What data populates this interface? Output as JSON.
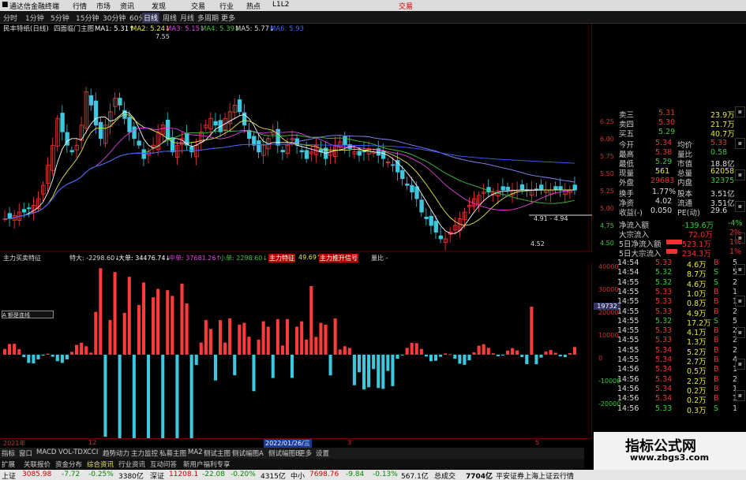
{
  "title_bar": {
    "app_title": "通达信金融终端",
    "menus": [
      "行情",
      "市场",
      "资讯",
      "发现",
      "交易",
      "行业",
      "热点",
      "L1L2"
    ],
    "trade_label": "交易"
  },
  "toolbar": {
    "periods": [
      "分时",
      "1分钟",
      "5分钟",
      "15分钟",
      "30分钟",
      "60分钟",
      "日线",
      "周线",
      "月线",
      "多周期",
      "更多"
    ]
  },
  "main_legend": {
    "chart_name": "民丰特纸(日线)",
    "indicator_name": "四面临门主图",
    "ma1": "MA1: 5.31↑",
    "ma2": "MA2: 5.24↓",
    "ma3": "MA3: 5.15↓",
    "ma4": "MA4: 5.39↓",
    "ma5": "MA5: 5.77↓",
    "ma6": "MA6: 5.93"
  },
  "main_labels": {
    "high": "7.55",
    "low": "4.52",
    "range": "4.91 - 4.94"
  },
  "price_axis": [
    "6.25",
    "6.00",
    "5.75",
    "5.50",
    "5.25",
    "5.00",
    "4.75",
    "4.50"
  ],
  "indicator_header": {
    "name": "主力买卖特征",
    "item1": "特大: -2298.60↓",
    "item2": "大单: 34476.74↓",
    "item3": "中单: 37681.26↑",
    "item4": "小单: 2298.60↓",
    "item5": "主力特征",
    "item6": "49.69↑",
    "item7": "主力推升信号",
    "item8": "量比 -"
  },
  "indicator_axis": [
    "40000",
    "30000",
    "20000",
    "10000",
    "0",
    "-10000",
    "-20000"
  ],
  "indicator_value_box": "19732",
  "side_label": "A 额是连线",
  "date_bar": {
    "left_year": "2021年",
    "month_12": "12",
    "date_box": "2022/01/26/三",
    "month_3": "3",
    "month_5": "5"
  },
  "bottom_tabs": [
    "指标",
    "窗口",
    "MACD",
    "VOL-TDX",
    "CCI",
    "趋势动力",
    "主力监控",
    "私募主图",
    "MA2",
    "侧试主图",
    "侧试幅图A",
    "侧试幅图B",
    "更多",
    "设置"
  ],
  "bottom_tabs2": [
    "扩展",
    "关联报价",
    "资金分布",
    "综合资讯",
    "行业资讯",
    "互动问答",
    "新用户福利专享"
  ],
  "order_book_top": [
    {
      "label": "卖三",
      "price": "5.31",
      "vol": "23.9万"
    },
    {
      "label": "卖四",
      "price": "5.30",
      "vol": "21.7万"
    },
    {
      "label": "买五",
      "price": "5.29",
      "vol": "40.7万"
    }
  ],
  "stats": [
    {
      "l1": "今开",
      "v1": "5.34",
      "l2": "均价",
      "v2": "5.33"
    },
    {
      "l1": "最高",
      "v1": "5.38",
      "l2": "量比",
      "v2": "0.58"
    },
    {
      "l1": "最低",
      "v1": "5.29",
      "l2": "市值",
      "v2": "18.8亿"
    },
    {
      "l1": "现量",
      "v1": "561",
      "l2": "总量",
      "v2": "62058"
    },
    {
      "l1": "外盘",
      "v1": "29683",
      "l2": "内盘",
      "v2": "32375"
    }
  ],
  "stats2": [
    {
      "l1": "换手",
      "v1": "1.77%",
      "l2": "股本",
      "v2": "3.51亿"
    },
    {
      "l1": "净资",
      "v1": "4.02",
      "l2": "流通",
      "v2": "3.51亿"
    },
    {
      "l1": "收益(-)",
      "v1": "0.050",
      "l2": "PE(动)",
      "v2": "29.6"
    }
  ],
  "flows": [
    {
      "label": "净流入额",
      "value": "-139.6万",
      "pct": "-4%"
    },
    {
      "label": "大宗流入",
      "value": "72.0万",
      "pct": "2%"
    },
    {
      "label": "5日净流入额",
      "value": "523.1万",
      "pct": "1%"
    },
    {
      "label": "5日大宗流入",
      "value": "234.3万",
      "pct": "1%"
    }
  ],
  "ticks": [
    {
      "time": "14:54",
      "price": "5.33",
      "vol": "4.6万",
      "side": "B",
      "n": "5"
    },
    {
      "time": "14:54",
      "price": "5.32",
      "vol": "8.7万",
      "side": "S",
      "n": "5"
    },
    {
      "time": "14:55",
      "price": "5.32",
      "vol": "4.6万",
      "side": "S",
      "n": "2"
    },
    {
      "time": "14:55",
      "price": "5.33",
      "vol": "1.0万",
      "side": "B",
      "n": "1"
    },
    {
      "time": "14:55",
      "price": "5.33",
      "vol": "0.8万",
      "side": "B",
      "n": "1"
    },
    {
      "time": "14:55",
      "price": "5.33",
      "vol": "4.9万",
      "side": "B",
      "n": "2"
    },
    {
      "time": "14:55",
      "price": "5.32",
      "vol": "17.2万",
      "side": "S",
      "n": "5"
    },
    {
      "time": "14:55",
      "price": "5.33",
      "vol": "4.1万",
      "side": "B",
      "n": "2"
    },
    {
      "time": "14:55",
      "price": "5.33",
      "vol": "1.3万",
      "side": "B",
      "n": "2"
    },
    {
      "time": "14:55",
      "price": "5.34",
      "vol": "5.2万",
      "side": "B",
      "n": "2"
    },
    {
      "time": "14:55",
      "price": "5.34",
      "vol": "2.7万",
      "side": "B",
      "n": "4"
    },
    {
      "time": "14:56",
      "price": "5.34",
      "vol": "0.5万",
      "side": "B",
      "n": "1"
    },
    {
      "time": "14:56",
      "price": "5.34",
      "vol": "2.2万",
      "side": "B",
      "n": "2"
    },
    {
      "time": "14:56",
      "price": "5.34",
      "vol": "0.2万",
      "side": "B",
      "n": "1"
    },
    {
      "time": "14:56",
      "price": "5.34",
      "vol": "0.2万",
      "side": "B",
      "n": "1"
    },
    {
      "time": "14:56",
      "price": "5.33",
      "vol": "0.3万",
      "side": "S",
      "n": "1"
    }
  ],
  "watermark": {
    "title": "指标公式网",
    "url": "www.zbgs3.com"
  },
  "status_bar": {
    "sh_name": "上证",
    "sh_val": "3085.98",
    "sh_chg": "-7.72",
    "sh_pct": "-0.25%",
    "sh_amt": "3380亿",
    "sz_name": "深证",
    "sz_val": "11208.1",
    "sz_chg": "-22.08",
    "sz_pct": "-0.20%",
    "sz_amt": "4315亿",
    "zx_name": "中小",
    "zx_val": "7698.76",
    "zx_chg": "-9.84",
    "zx_pct": "-0.13%",
    "zx_amt": "567.1亿",
    "total_label": "总成交",
    "total_val": "7704亿",
    "broker": "平安证券上海上证云行情"
  },
  "colors": {
    "up": "#ff3b3b",
    "down": "#3cc9e0",
    "ma_white": "#ffffff",
    "ma_yellow": "#e8e84a",
    "ma_magenta": "#e040e0",
    "ma_green": "#40c040",
    "ma_blue": "#4060ff"
  }
}
